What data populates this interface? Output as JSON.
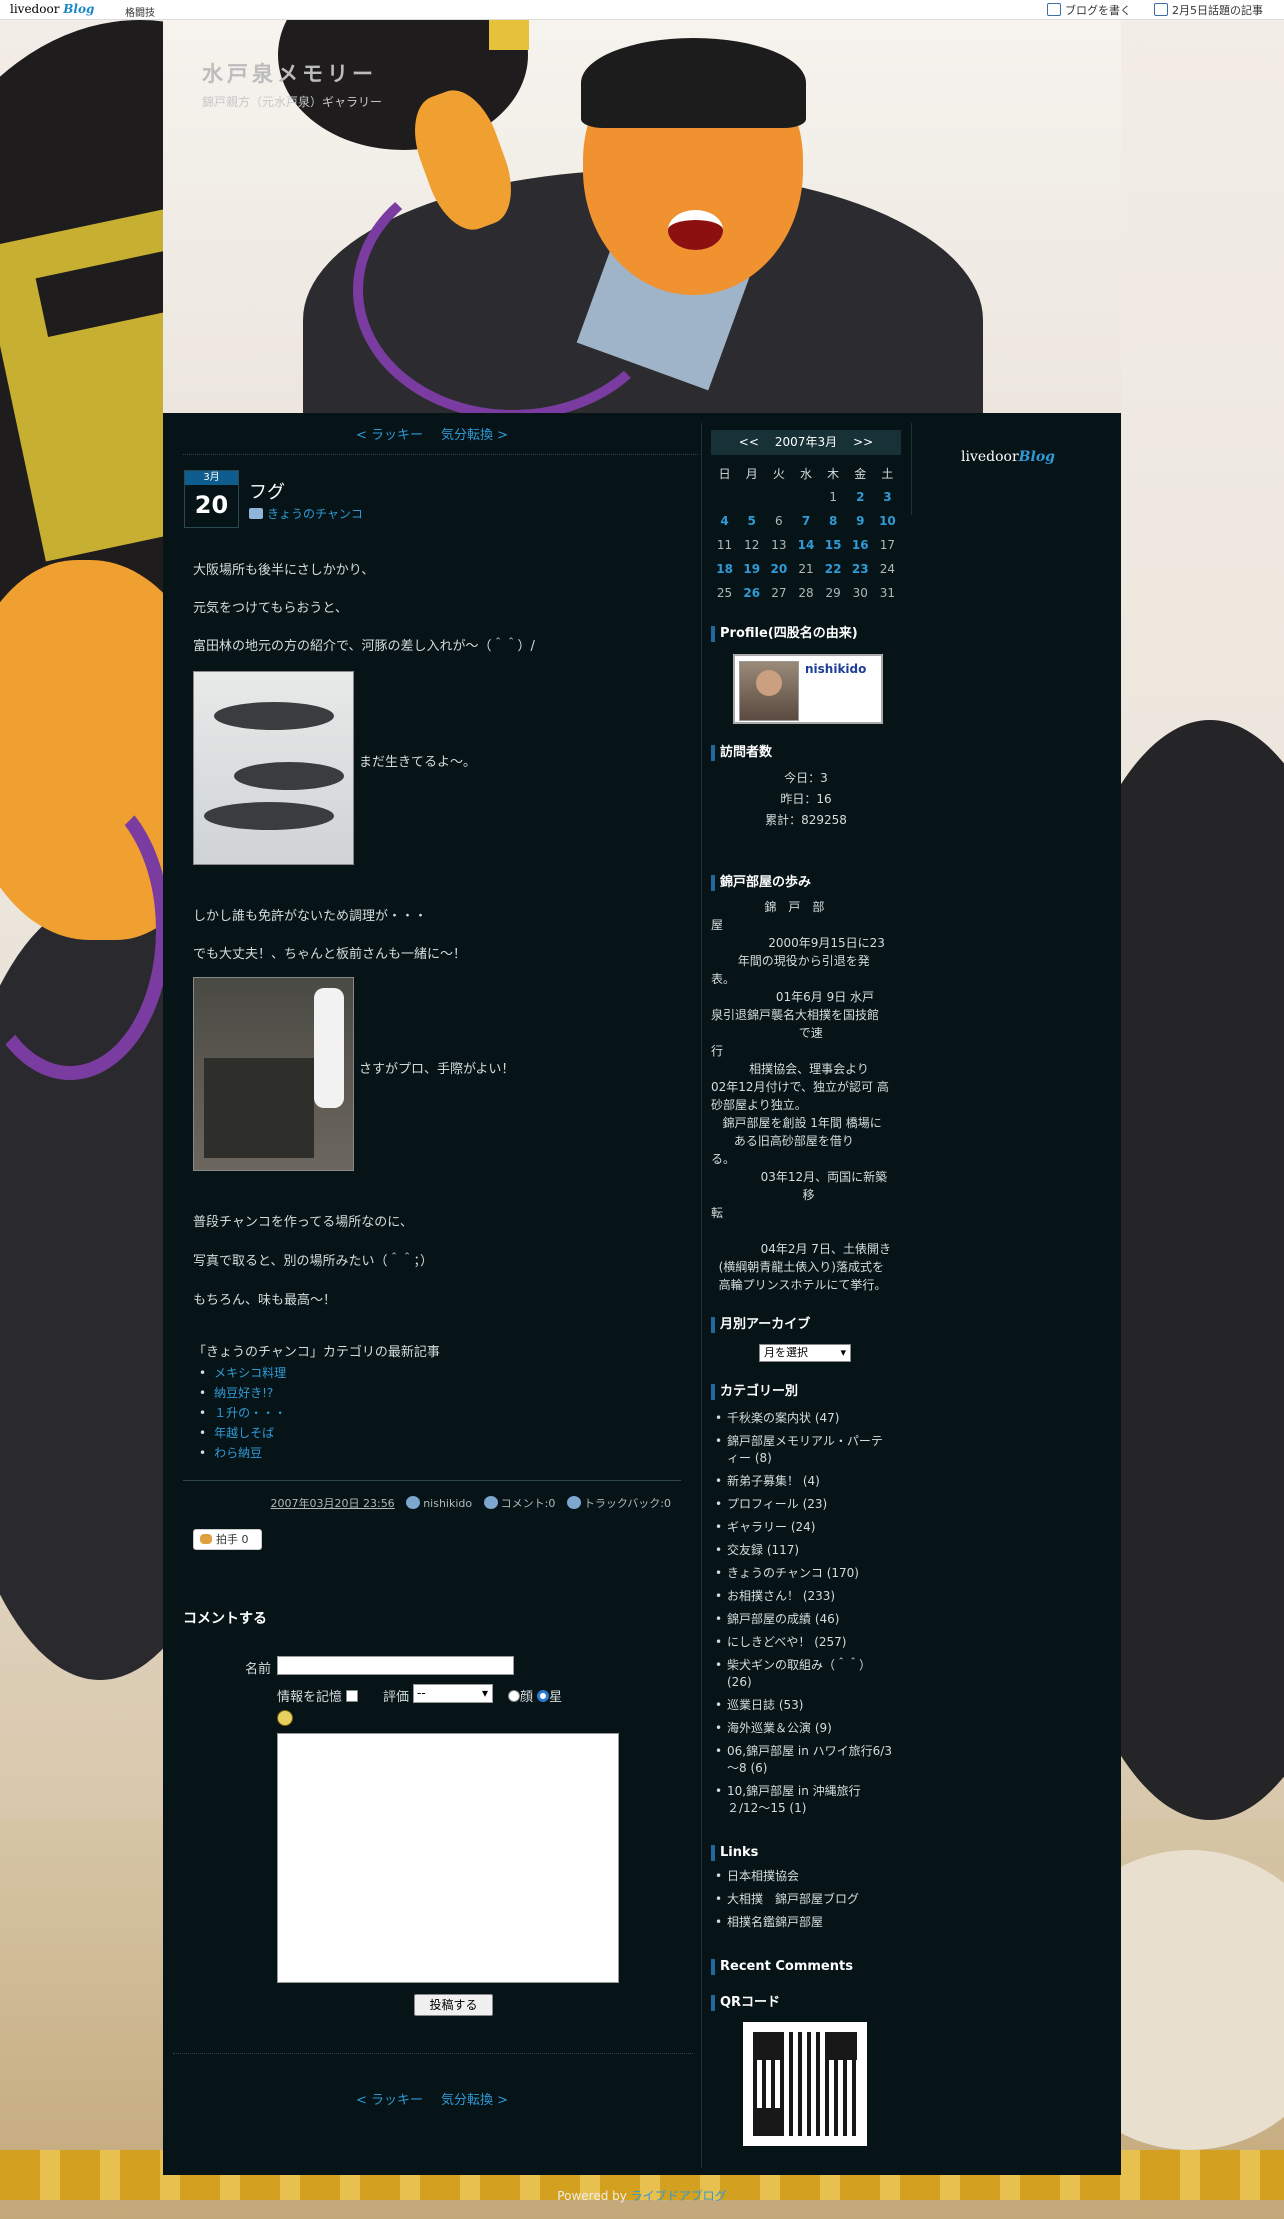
{
  "topbar": {
    "logo_text": "livedoor",
    "logo_blog": "Blog",
    "user": "格闘技",
    "write": "ブログを書く",
    "today": "2月5日話題の記事"
  },
  "header": {
    "title": "水戸泉メモリー",
    "subtitle": "錦戸親方（元水戸泉）ギャラリー"
  },
  "nav": {
    "prev": "< ラッキー",
    "next": "気分転換 >"
  },
  "entry": {
    "month": "3月",
    "day": "20",
    "title": "フグ",
    "category": "きょうのチャンコ",
    "paragraphs": [
      "大阪場所も後半にさしかかり、",
      "元気をつけてもらおうと、",
      "富田林の地元の方の紹介で、河豚の差し入れが～（＾＾）/"
    ],
    "photo1_caption": "まだ生きてるよ～。",
    "paragraphs2": [
      "しかし誰も免許がないため調理が・・・",
      "でも大丈夫！、ちゃんと板前さんも一緒に～！"
    ],
    "photo2_caption": "さすがプロ、手際がよい！",
    "paragraphs3": [
      "普段チャンコを作ってる場所なのに、",
      "写真で取ると、別の場所みたい（＾＾；）",
      "もちろん、味も最高～！"
    ],
    "related_head": "「きょうのチャンコ」カテゴリの最新記事",
    "related": [
      "メキシコ料理",
      "納豆好き!?",
      "１升の・・・",
      "年越しそば",
      "わら納豆"
    ],
    "posted": "2007年03月20日 23:56",
    "author": "nishikido",
    "comments": "コメント:0",
    "trackback": "トラックバック:0",
    "clap": "拍手",
    "clap_count": "0"
  },
  "comment_form": {
    "heading": "コメントする",
    "name_label": "名前",
    "remember": "情報を記憶",
    "rating_label": "評価",
    "rating_value": "--",
    "face": "顔",
    "star": "星",
    "submit": "投稿する"
  },
  "calendar": {
    "prev": "<<",
    "label": "2007年3月",
    "next": ">>",
    "weekdays": [
      "日",
      "月",
      "火",
      "水",
      "木",
      "金",
      "土"
    ],
    "rows": [
      [
        "",
        "",
        "",
        "",
        "1",
        "2",
        "3"
      ],
      [
        "4",
        "5",
        "6",
        "7",
        "8",
        "9",
        "10"
      ],
      [
        "11",
        "12",
        "13",
        "14",
        "15",
        "16",
        "17"
      ],
      [
        "18",
        "19",
        "20",
        "21",
        "22",
        "23",
        "24"
      ],
      [
        "25",
        "26",
        "27",
        "28",
        "29",
        "30",
        "31"
      ]
    ],
    "linked": [
      "2",
      "3",
      "4",
      "5",
      "7",
      "8",
      "9",
      "10",
      "14",
      "15",
      "16",
      "18",
      "19",
      "20",
      "22",
      "23",
      "26"
    ]
  },
  "sidebar": {
    "profile_head": "Profile(四股名の由来)",
    "profile_name": "nishikido",
    "visitors_head": "訪問者数",
    "today": "今日：3",
    "yesterday": "昨日：16",
    "total": "累計：829258",
    "history_head": "錦戸部屋の歩み",
    "history": [
      "              錦　戸　部",
      "屋",
      "               2000年9月15日に23",
      "       年間の現役から引退を発",
      "表。",
      "                 01年6月 9日 水戸",
      "泉引退錦戸襲名大相撲を国技館",
      "                       で速",
      "行",
      "          相撲協会、理事会より",
      "02年12月付けで、独立が認可 高",
      "砂部屋より独立。",
      "   錦戸部屋を創設 1年間 橋場に",
      "      ある旧高砂部屋を借り",
      "る。",
      "             03年12月、両国に新築",
      "                        移",
      "転",
      "",
      "             04年2月 7日、土俵開き",
      "  (横綱朝青龍土俵入り)落成式を",
      "  高輪プリンスホテルにて挙行。"
    ],
    "archive_head": "月別アーカイブ",
    "archive_select": "月を選択",
    "category_head": "カテゴリー別",
    "categories": [
      "千秋楽の案内状 (47)",
      "錦戸部屋メモリアル・パーテ\nィー (8)",
      "新弟子募集！ (4)",
      "プロフィール (23)",
      "ギャラリー (24)",
      "交友録 (117)",
      "きょうのチャンコ (170)",
      "お相撲さん！ (233)",
      "錦戸部屋の成績 (46)",
      "にしきどべや！ (257)",
      "柴犬ギンの取組み（＾＾）\n(26)",
      "巡業日誌 (53)",
      "海外巡業＆公演 (9)",
      "06,錦戸部屋 in ハワイ旅行6/3\n～8 (6)",
      "10,錦戸部屋 in 沖縄旅行\n２/12～15 (1)"
    ],
    "links_head": "Links",
    "links": [
      "日本相撲協会",
      "大相撲　錦戸部屋ブログ",
      "相撲名鑑錦戸部屋"
    ],
    "recent_head": "Recent Comments",
    "qr_head": "QRコード"
  },
  "powered": {
    "prefix": "Powered by ",
    "link": "ライブドアブログ"
  },
  "colors": {
    "background": "#061417",
    "link": "#2f9ad6",
    "accent": "#1e6a9e"
  }
}
